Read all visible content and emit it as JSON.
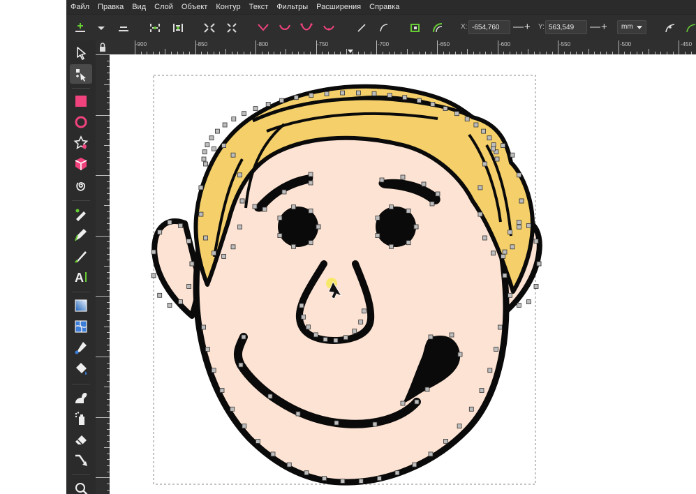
{
  "menu": [
    "Файл",
    "Правка",
    "Вид",
    "Слой",
    "Объект",
    "Контур",
    "Текст",
    "Фильтры",
    "Расширения",
    "Справка"
  ],
  "toolbar": {
    "x_label": "X:",
    "x_value": "-654,760",
    "y_label": "Y:",
    "y_value": "563,549",
    "unit": "mm",
    "minus": "—",
    "plus": "+"
  },
  "ruler": {
    "h_labels": [
      "-900",
      "-850",
      "-800",
      "-750",
      "-700",
      "-650",
      "-600",
      "-550",
      "-500",
      "-450"
    ]
  },
  "colors": {
    "skin": "#fde3d3",
    "hair": "#f5d06a",
    "outline": "#0a0a0a",
    "node": "#bdbdbd",
    "tool_accent": "#f0437e",
    "tool_green": "#66cc33"
  },
  "tools": [
    "selector-tool",
    "node-tool",
    "rect-tool",
    "ellipse-tool",
    "star-tool",
    "3dbox-tool",
    "spiral-tool",
    "bezier-tool",
    "pencil-tool",
    "calligraphy-tool",
    "text-tool",
    "gradient-tool",
    "mesh-tool",
    "dropper-tool",
    "paint-bucket-tool",
    "tweak-tool",
    "spray-tool",
    "eraser-tool",
    "connector-tool",
    "zoom-tool"
  ]
}
